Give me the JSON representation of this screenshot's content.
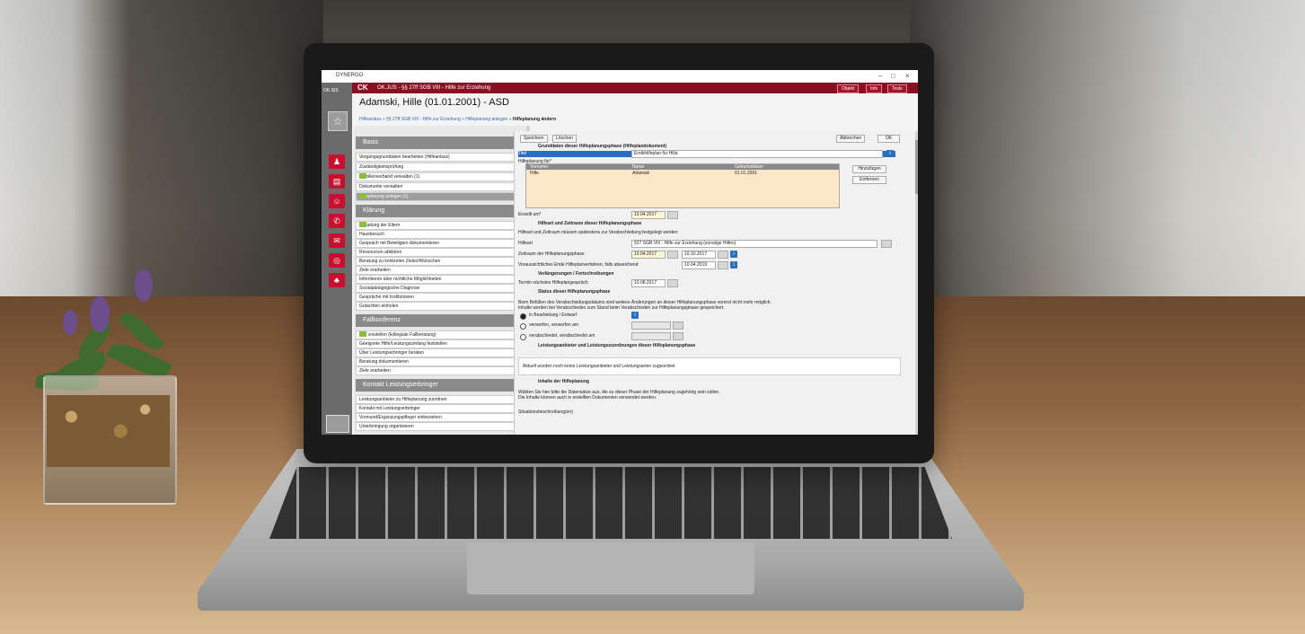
{
  "window": {
    "app_name": "DYNERGO",
    "minimize": "–",
    "maximize": "□",
    "close": "×"
  },
  "leftbar": {
    "logo": "OK.SIS"
  },
  "header": {
    "logo": "CK",
    "title": "OK.JUS - §§ 27ff SGB VIII - Hilfe zur Erziehung",
    "buttons": [
      "Objekt",
      "Info",
      "Tools"
    ]
  },
  "page": {
    "title": "Adamski, Hille (01.01.2001) - ASD",
    "breadcrumb_links": "Hilfeanlass » §§ 27ff SGB VIII - Hilfe zur Erziehung » Hilfeplanung anlegen »",
    "breadcrumb_current": "Hilfeplanung ändern"
  },
  "sidebar": {
    "sections": [
      {
        "title": "Basis",
        "items": [
          {
            "label": "Vorgangsgrunddaten bearbeiten (Hilfeanlass)",
            "status": "warn"
          },
          {
            "label": "Zuständigkeitsprüfung",
            "status": ""
          },
          {
            "label": "Familienverband verwalten (1)",
            "status": "ok"
          },
          {
            "label": "Dokumente verwalten",
            "status": ""
          },
          {
            "label": "Hilfeplanung anlegen (1)",
            "status": "ok"
          }
        ]
      },
      {
        "title": "Klärung",
        "items": [
          {
            "label": "Einladung der Eltern",
            "status": "ok"
          },
          {
            "label": "Hausbesuch",
            "status": ""
          },
          {
            "label": "Gespräch mit Beteiligten dokumentieren",
            "status": ""
          },
          {
            "label": "Ressourcen abklären",
            "status": ""
          },
          {
            "label": "Beratung zu konkreten Zielen/Wünschen",
            "status": ""
          },
          {
            "label": "Ziele erarbeiten",
            "status": ""
          },
          {
            "label": "Informieren über rechtliche Möglichkeiten",
            "status": ""
          },
          {
            "label": "Sozialpädagogische Diagnose",
            "status": ""
          },
          {
            "label": "Gespräche mit Institutionen",
            "status": ""
          },
          {
            "label": "Gutachten einholen",
            "status": ""
          }
        ]
      },
      {
        "title": "Fallkonferenz",
        "items": [
          {
            "label": "Fall vorstellen (kollegiale Fallberatung)",
            "status": "ok"
          },
          {
            "label": "Geeignete Hilfe/Leistungsumfang feststellen",
            "status": ""
          },
          {
            "label": "Über Leistungserbringer beraten",
            "status": ""
          },
          {
            "label": "Beratung dokumentieren",
            "status": ""
          },
          {
            "label": "Ziele erarbeiten",
            "status": ""
          }
        ]
      },
      {
        "title": "Kontakt Leistungserbringer",
        "items": [
          {
            "label": "Leistungsanbieter zu Hilfeplanung zuordnen",
            "status": ""
          },
          {
            "label": "Kontakt mit Leistungserbringer",
            "status": ""
          },
          {
            "label": "Vormund/Ergänzungspfleger einbeziehen",
            "status": ""
          },
          {
            "label": "Unterbringung organisieren",
            "status": ""
          }
        ]
      }
    ]
  },
  "toolbar": {
    "save": "Speichern",
    "delete": "Löschen",
    "cancel": "Abbrechen",
    "ok": "OK"
  },
  "form": {
    "sec_grunddaten": "Grunddaten dieser Hilfeplanungsphase (Hilfeplandokument)",
    "titel_label": "Titel",
    "titel_value": "Erstkhilfeplan für Hilla",
    "hilfeplanung_fuer": "Hilfeplanung für*",
    "grid_headers": [
      "Vorname",
      "Name",
      "Geburtsdatum"
    ],
    "grid_row": [
      "Hille",
      "Adamski",
      "01.01.2001"
    ],
    "btn_hinzufuegen": "Hinzufügen",
    "btn_entfernen": "Entfernen",
    "erstellt_label": "Erstellt am*",
    "erstellt_value": "10.04.2017",
    "sec_hilfeart": "Hilfeart und Zeitraum dieser Hilfeplanungsphase",
    "hilfeart_hint": "Hilfeart und Zeitraum müssen spätestens zur Verabschiedung festgelegt werden",
    "hilfeart_label": "Hilfeart",
    "hilfeart_value": "§27 SGB VIII - Hilfe zur Erziehung (sonstige Hilfen)",
    "zeitraum_label": "Zeitraum der Hilfeplanungsphase",
    "zeitraum_from": "10.04.2017",
    "zeitraum_to": "10.10.2017",
    "ende_label": "Voraussichtliches Ende Hilfeplanverfahren, falls abweichend",
    "ende_value": "10.04.2019",
    "sec_verlaengerung": "Verlängerungen / Fortschreibungen",
    "termin_label": "Termin nächstes Hilfeplangespräch",
    "termin_value": "10.08.2017",
    "sec_status": "Status dieser Hilfeplanungsphase",
    "status_hint1": "Beim Befüllen des Verabschiedungsdatums sind weitere Änderungen an dieser Hilfeplanungsphase vorerst nicht mehr möglich.",
    "status_hint2": "Inhalte werden bei Verabschieden zum Stand beim Verabschieden zur Hilfeplanungsphase gespeichert.",
    "radio_1": "in Bearbeitung / Entwurf",
    "radio_2": "verworfen, verworfen am",
    "radio_3": "verabschiedet, verabschiedet am",
    "sec_leistung": "Leistungsanbieter und Leistungszuordnungen dieser Hilfeplanungsphase",
    "leistung_text": "Aktuell wurden noch keine Leistungsanbieter und Leistungsarten zugeordnet",
    "sec_inhalte": "Inhalte der Hilfeplanung",
    "inhalte_hint1": "Wählen Sie hier bitte die Datensätze aus, die zu dieser Phase der Hilfeplanung zugehörig sein sollen.",
    "inhalte_hint2": "Die Inhalte können auch in erstellten Dokumenten verwendet werden.",
    "situation_label": "Situationsbeschreibung(en)"
  }
}
